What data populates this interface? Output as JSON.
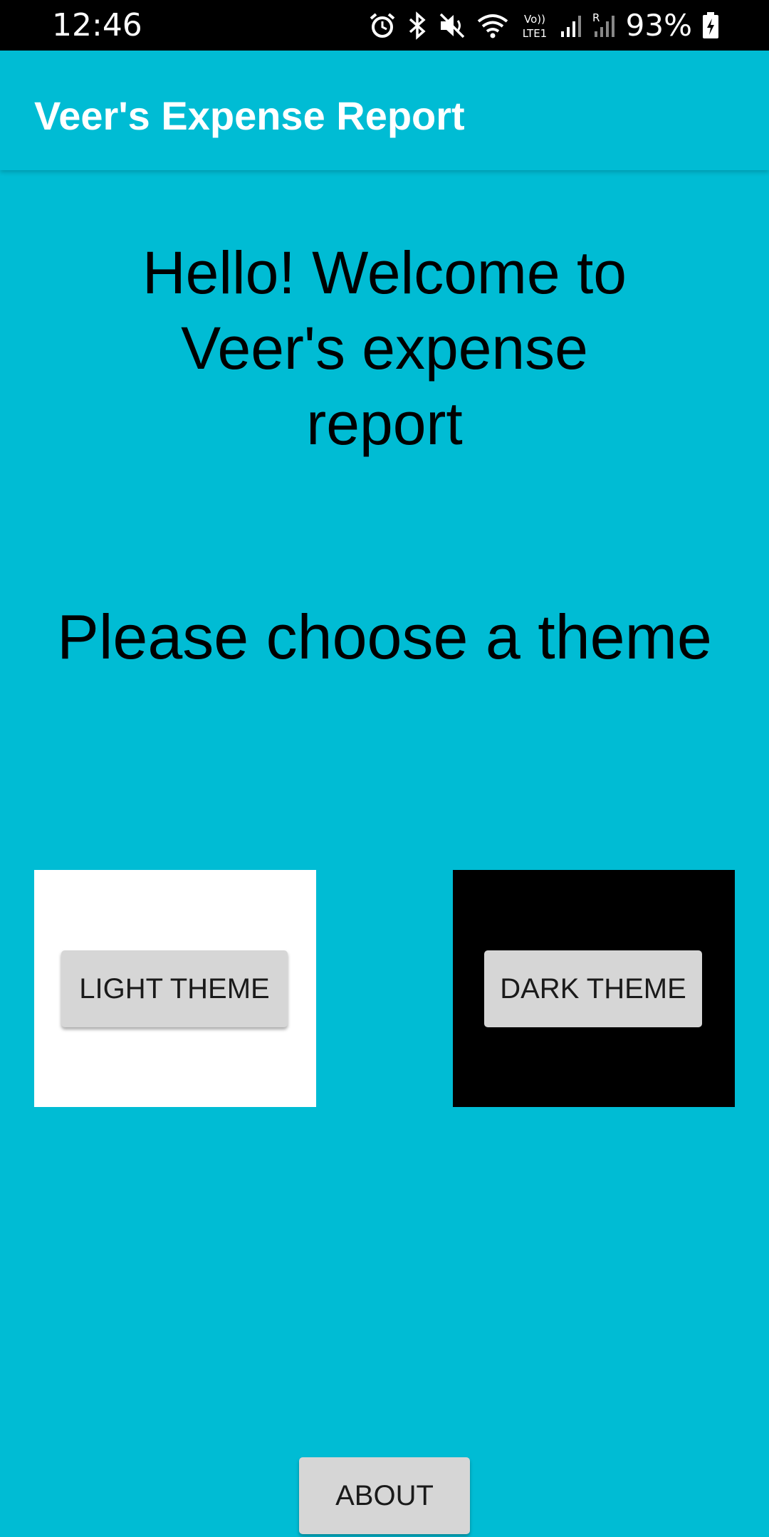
{
  "status_bar": {
    "time": "12:46",
    "battery_percent": "93%",
    "icons": [
      "alarm-icon",
      "bluetooth-icon",
      "mute-icon",
      "wifi-icon",
      "volte-icon",
      "signal-icon",
      "roaming-signal-icon",
      "battery-charging-icon"
    ],
    "volte_label_top": "Vo))",
    "volte_label_bottom": "LTE1",
    "roaming_label": "R"
  },
  "app_bar": {
    "title": "Veer's Expense Report"
  },
  "main": {
    "welcome_text": "Hello! Welcome to Veer's expense report",
    "prompt_text": "Please choose a theme",
    "light_theme_button": "LIGHT THEME",
    "dark_theme_button": "DARK THEME",
    "about_button": "ABOUT"
  },
  "colors": {
    "background": "#00BCD4",
    "status_bar": "#000000",
    "light_panel": "#FFFFFF",
    "dark_panel": "#000000",
    "button": "#D6D6D6"
  }
}
